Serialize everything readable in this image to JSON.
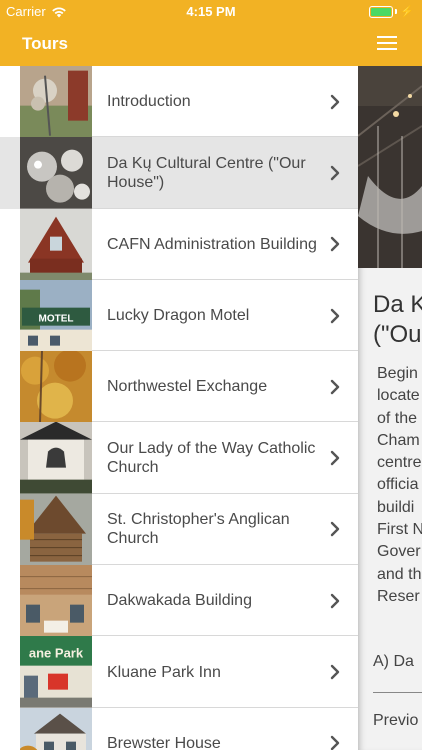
{
  "status_bar": {
    "carrier": "Carrier",
    "time": "4:15 PM",
    "battery_level": 1.0
  },
  "colors": {
    "header": "#f2b224",
    "selected_row": "#e5e5e5",
    "battery": "#4cd964"
  },
  "menu": {
    "title": "Tours",
    "items": [
      {
        "label": "Introduction",
        "thumbnail": "decorative-sculpture-photo"
      },
      {
        "label": "Da Kų Cultural Centre (\"Our House\")",
        "thumbnail": "glass-ornaments-photo",
        "selected": true
      },
      {
        "label": "CAFN Administration Building",
        "thumbnail": "a-frame-building-photo"
      },
      {
        "label": "Lucky Dragon Motel",
        "thumbnail": "motel-sign-photo"
      },
      {
        "label": "Northwestel Exchange",
        "thumbnail": "autumn-trees-photo"
      },
      {
        "label": "Our Lady of the Way Catholic Church",
        "thumbnail": "church-bell-photo"
      },
      {
        "label": "St. Christopher's Anglican Church",
        "thumbnail": "log-church-photo"
      },
      {
        "label": "Dakwakada Building",
        "thumbnail": "dakwakada-building-photo"
      },
      {
        "label": "Kluane Park Inn",
        "thumbnail": "kluane-park-inn-sign-photo"
      },
      {
        "label": "Brewster House",
        "thumbnail": "brewster-house-photo"
      }
    ]
  },
  "content": {
    "menu_button_icon": "hamburger-icon",
    "title": "Da K\n(\"Ou",
    "body_lines": [
      "Begin",
      "locate",
      "of the",
      "Cham",
      "centre",
      "officia",
      "buildi",
      "First N",
      "Gover",
      "and th",
      "Reser"
    ],
    "audio_label": "A) Da",
    "previous_label": "Previo"
  }
}
